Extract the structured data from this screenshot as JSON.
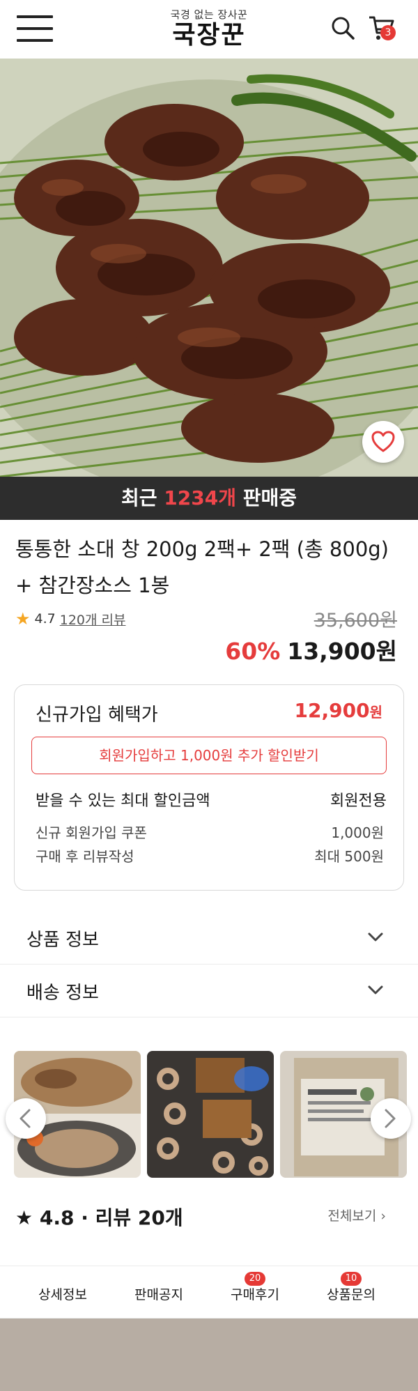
{
  "header": {
    "tagline": "국경 없는 장사꾼",
    "brand": "국장꾼",
    "cart_count": "3"
  },
  "hero": {
    "sales_prefix": "최근 ",
    "sales_count": "1234개",
    "sales_suffix": " 판매중"
  },
  "product": {
    "title_line1": "통통한 소대 창 200g 2팩+ 2팩 (총 800g)",
    "title_line2": "+ 참간장소스 1봉",
    "rating": "4.7",
    "review_link": "120개 리뷰",
    "original_price": "35,600원",
    "discount": "60%",
    "price": "13,900원"
  },
  "coupon": {
    "title": "신규가입 혜택가",
    "price_value": "12,900",
    "price_unit": "원",
    "signup_button": "회원가입하고 1,000원 추가 할인받기",
    "max_label": "받을 수 있는 최대 할인금액",
    "max_value": "회원전용",
    "details": [
      {
        "label": "신규 회원가입 쿠폰",
        "value": "1,000원"
      },
      {
        "label": "구매 후 리뷰작성",
        "value": "최대 500원"
      }
    ]
  },
  "accordions": {
    "product_info": "상품 정보",
    "shipping_info": "배송 정보"
  },
  "reviews": {
    "summary": "4.8 · 리뷰 20개",
    "view_all": "전체보기"
  },
  "tabs": [
    {
      "label": "상세정보",
      "badge": ""
    },
    {
      "label": "판매공지",
      "badge": ""
    },
    {
      "label": "구매후기",
      "badge": "20"
    },
    {
      "label": "상품문의",
      "badge": "10"
    }
  ],
  "colors": {
    "accent": "#e53c3c",
    "banner_bg": "#2d2d2d",
    "star": "#f5a623"
  },
  "icons": [
    "menu-icon",
    "search-icon",
    "cart-icon",
    "heart-icon",
    "chevron-down-icon",
    "chevron-left-icon",
    "chevron-right-icon",
    "star-icon"
  ]
}
